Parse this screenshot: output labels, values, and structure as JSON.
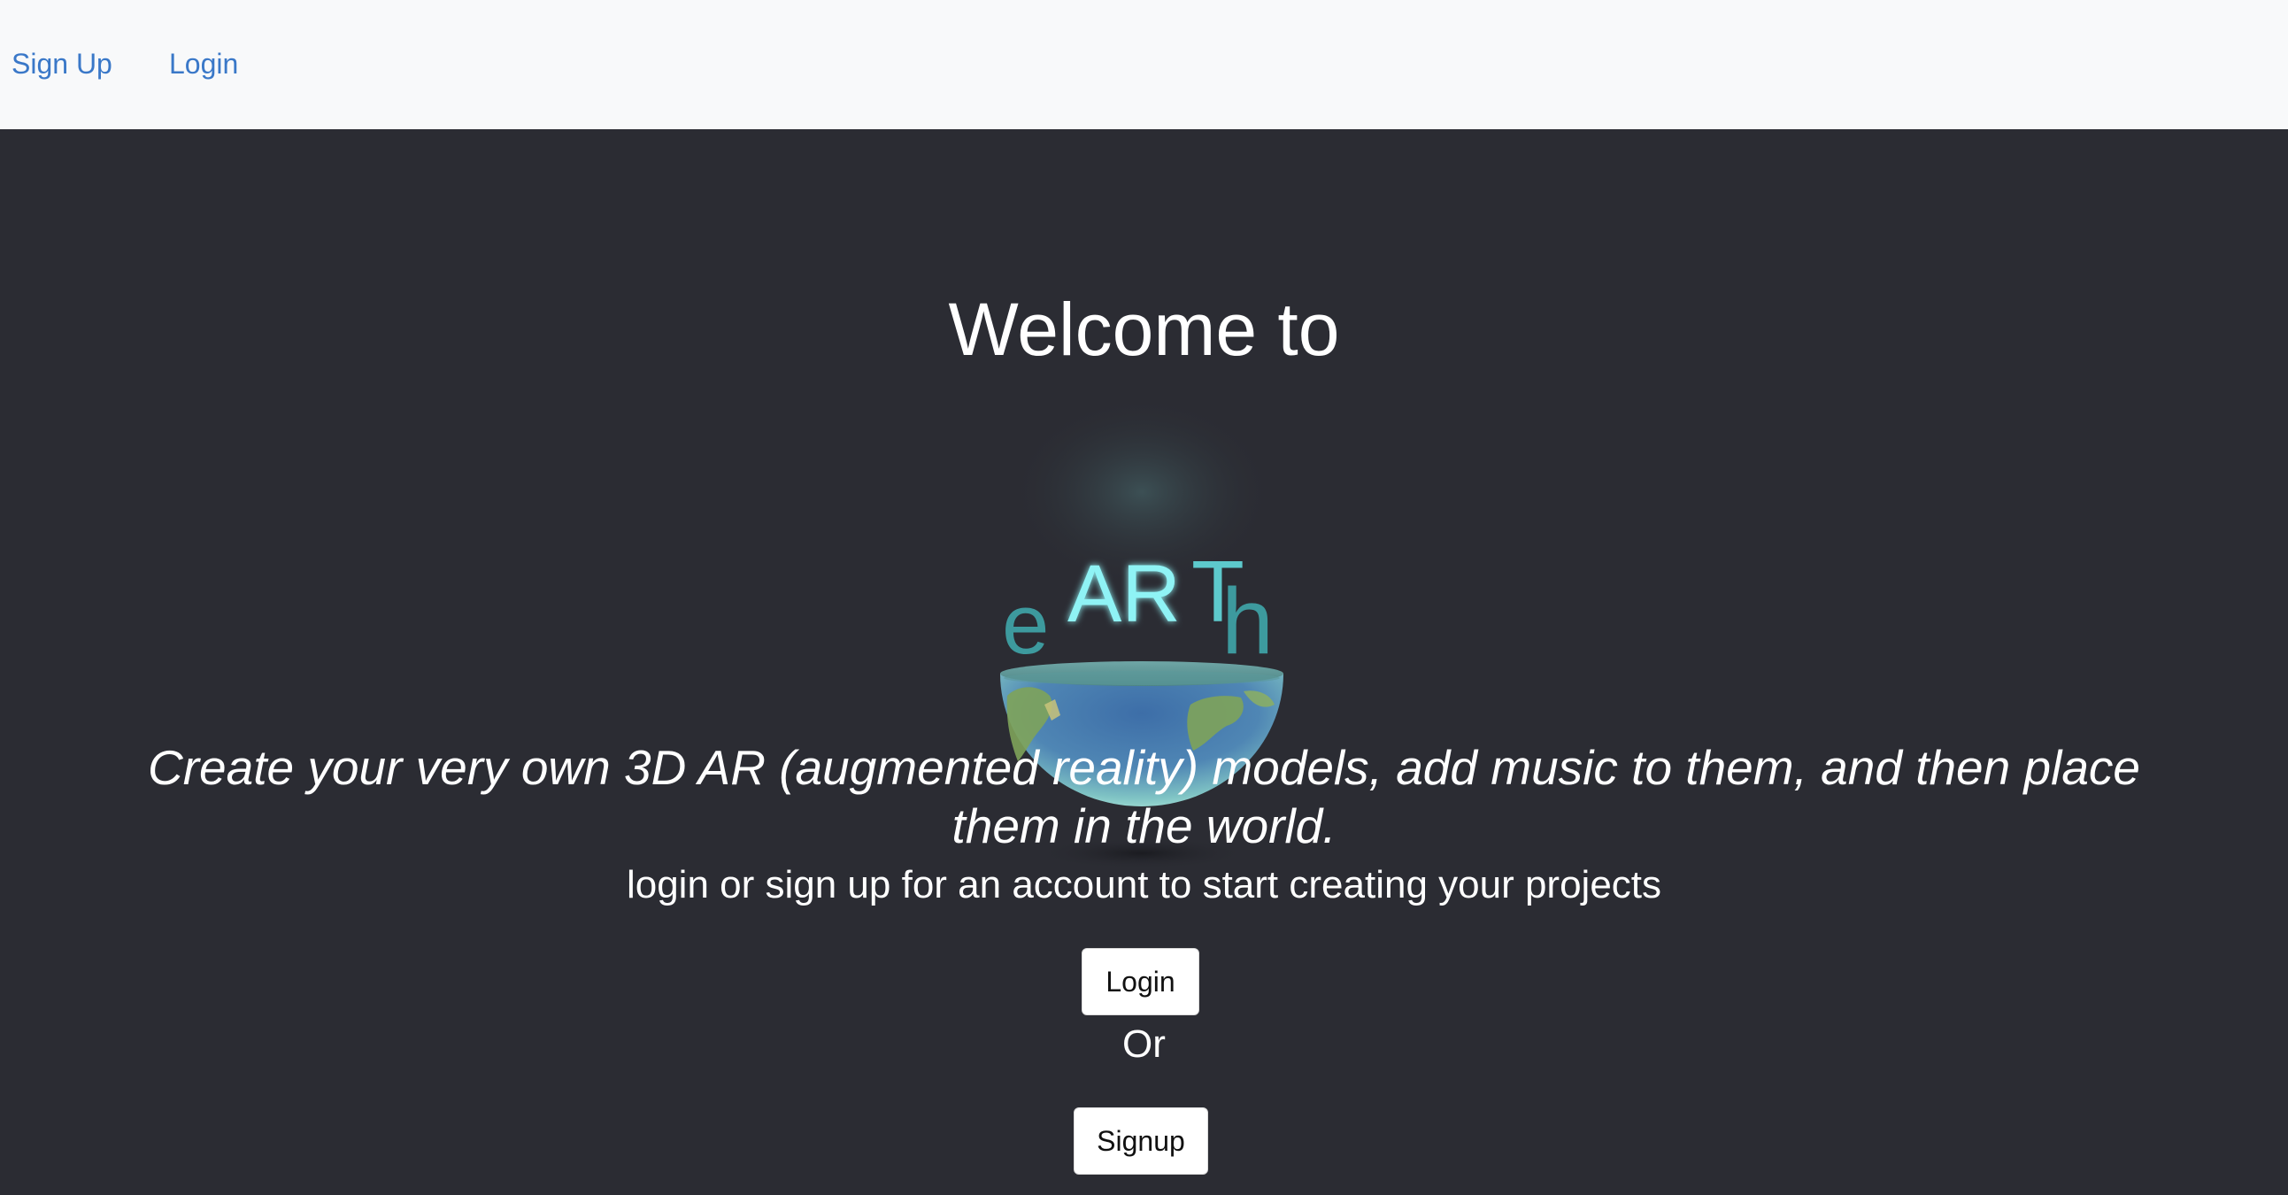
{
  "nav": {
    "signup_label": "Sign Up",
    "login_label": "Login",
    "link_color": "#3a78c8",
    "background": "#f8f9fa"
  },
  "hero": {
    "background": "#2b2c33",
    "welcome": "Welcome to",
    "logo": {
      "text_e": "e",
      "text_ar": "AR",
      "text_t": "T",
      "text_h": "h",
      "teal": "#3d9a9e",
      "glow": "#8ff3f5"
    },
    "tagline": "Create your very own 3D AR (augmented reality) models, add music to them, and then place them in the world.",
    "subtitle": "login or sign up for an account to start creating your projects",
    "login_button": "Login",
    "or_text": "Or",
    "signup_button": "Signup"
  }
}
